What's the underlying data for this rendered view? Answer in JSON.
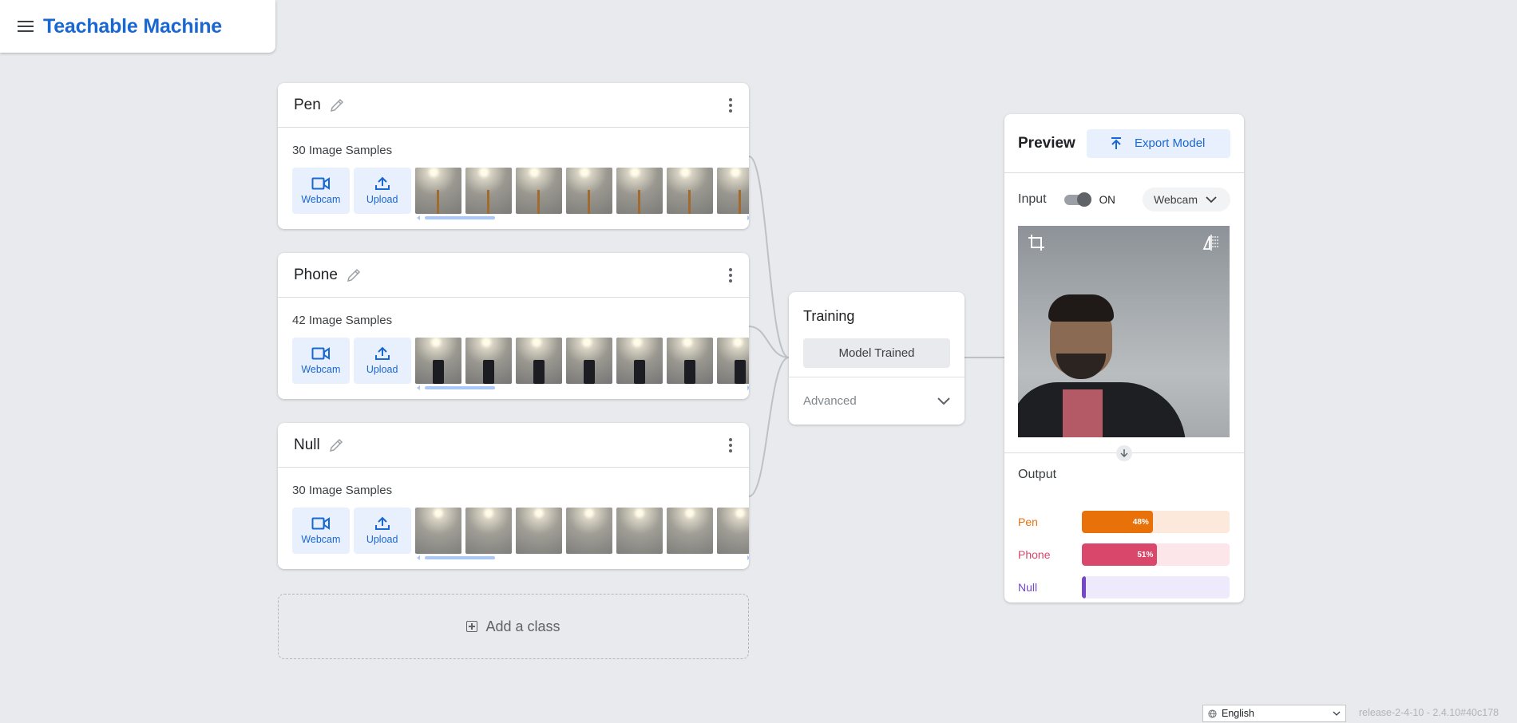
{
  "header": {
    "title": "Teachable Machine"
  },
  "classes": [
    {
      "name": "Pen",
      "samples": "30 Image Samples",
      "thumb": "pen"
    },
    {
      "name": "Phone",
      "samples": "42 Image Samples",
      "thumb": "phone"
    },
    {
      "name": "Null",
      "samples": "30 Image Samples",
      "thumb": "null"
    }
  ],
  "sample_sources": {
    "webcam": "Webcam",
    "upload": "Upload"
  },
  "add_class": "Add a class",
  "training": {
    "title": "Training",
    "button": "Model Trained",
    "advanced": "Advanced"
  },
  "preview": {
    "title": "Preview",
    "export": "Export Model",
    "input_label": "Input",
    "toggle_state": "ON",
    "source": "Webcam",
    "output_title": "Output",
    "outputs": [
      {
        "label": "Pen",
        "value": 0.48,
        "text": "48%",
        "color": "#e8710a",
        "bg": "#fde8dc"
      },
      {
        "label": "Phone",
        "value": 0.51,
        "text": "51%",
        "color": "#d9476b",
        "bg": "#fce6ea"
      },
      {
        "label": "Null",
        "value": 0.01,
        "text": "",
        "color": "#7448c9",
        "bg": "#efeafb"
      }
    ]
  },
  "footer": {
    "language": "English",
    "release": "release-2-4-10 - 2.4.10#40c178"
  },
  "colors": {
    "accent": "#1967d2",
    "background": "#e8eaed"
  }
}
